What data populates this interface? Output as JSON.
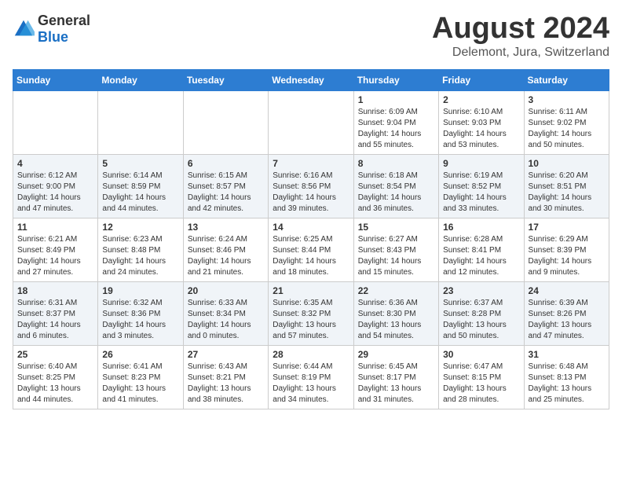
{
  "logo": {
    "general": "General",
    "blue": "Blue"
  },
  "title": "August 2024",
  "subtitle": "Delemont, Jura, Switzerland",
  "days_of_week": [
    "Sunday",
    "Monday",
    "Tuesday",
    "Wednesday",
    "Thursday",
    "Friday",
    "Saturday"
  ],
  "weeks": [
    [
      {
        "day": "",
        "info": ""
      },
      {
        "day": "",
        "info": ""
      },
      {
        "day": "",
        "info": ""
      },
      {
        "day": "",
        "info": ""
      },
      {
        "day": "1",
        "info": "Sunrise: 6:09 AM\nSunset: 9:04 PM\nDaylight: 14 hours\nand 55 minutes."
      },
      {
        "day": "2",
        "info": "Sunrise: 6:10 AM\nSunset: 9:03 PM\nDaylight: 14 hours\nand 53 minutes."
      },
      {
        "day": "3",
        "info": "Sunrise: 6:11 AM\nSunset: 9:02 PM\nDaylight: 14 hours\nand 50 minutes."
      }
    ],
    [
      {
        "day": "4",
        "info": "Sunrise: 6:12 AM\nSunset: 9:00 PM\nDaylight: 14 hours\nand 47 minutes."
      },
      {
        "day": "5",
        "info": "Sunrise: 6:14 AM\nSunset: 8:59 PM\nDaylight: 14 hours\nand 44 minutes."
      },
      {
        "day": "6",
        "info": "Sunrise: 6:15 AM\nSunset: 8:57 PM\nDaylight: 14 hours\nand 42 minutes."
      },
      {
        "day": "7",
        "info": "Sunrise: 6:16 AM\nSunset: 8:56 PM\nDaylight: 14 hours\nand 39 minutes."
      },
      {
        "day": "8",
        "info": "Sunrise: 6:18 AM\nSunset: 8:54 PM\nDaylight: 14 hours\nand 36 minutes."
      },
      {
        "day": "9",
        "info": "Sunrise: 6:19 AM\nSunset: 8:52 PM\nDaylight: 14 hours\nand 33 minutes."
      },
      {
        "day": "10",
        "info": "Sunrise: 6:20 AM\nSunset: 8:51 PM\nDaylight: 14 hours\nand 30 minutes."
      }
    ],
    [
      {
        "day": "11",
        "info": "Sunrise: 6:21 AM\nSunset: 8:49 PM\nDaylight: 14 hours\nand 27 minutes."
      },
      {
        "day": "12",
        "info": "Sunrise: 6:23 AM\nSunset: 8:48 PM\nDaylight: 14 hours\nand 24 minutes."
      },
      {
        "day": "13",
        "info": "Sunrise: 6:24 AM\nSunset: 8:46 PM\nDaylight: 14 hours\nand 21 minutes."
      },
      {
        "day": "14",
        "info": "Sunrise: 6:25 AM\nSunset: 8:44 PM\nDaylight: 14 hours\nand 18 minutes."
      },
      {
        "day": "15",
        "info": "Sunrise: 6:27 AM\nSunset: 8:43 PM\nDaylight: 14 hours\nand 15 minutes."
      },
      {
        "day": "16",
        "info": "Sunrise: 6:28 AM\nSunset: 8:41 PM\nDaylight: 14 hours\nand 12 minutes."
      },
      {
        "day": "17",
        "info": "Sunrise: 6:29 AM\nSunset: 8:39 PM\nDaylight: 14 hours\nand 9 minutes."
      }
    ],
    [
      {
        "day": "18",
        "info": "Sunrise: 6:31 AM\nSunset: 8:37 PM\nDaylight: 14 hours\nand 6 minutes."
      },
      {
        "day": "19",
        "info": "Sunrise: 6:32 AM\nSunset: 8:36 PM\nDaylight: 14 hours\nand 3 minutes."
      },
      {
        "day": "20",
        "info": "Sunrise: 6:33 AM\nSunset: 8:34 PM\nDaylight: 14 hours\nand 0 minutes."
      },
      {
        "day": "21",
        "info": "Sunrise: 6:35 AM\nSunset: 8:32 PM\nDaylight: 13 hours\nand 57 minutes."
      },
      {
        "day": "22",
        "info": "Sunrise: 6:36 AM\nSunset: 8:30 PM\nDaylight: 13 hours\nand 54 minutes."
      },
      {
        "day": "23",
        "info": "Sunrise: 6:37 AM\nSunset: 8:28 PM\nDaylight: 13 hours\nand 50 minutes."
      },
      {
        "day": "24",
        "info": "Sunrise: 6:39 AM\nSunset: 8:26 PM\nDaylight: 13 hours\nand 47 minutes."
      }
    ],
    [
      {
        "day": "25",
        "info": "Sunrise: 6:40 AM\nSunset: 8:25 PM\nDaylight: 13 hours\nand 44 minutes."
      },
      {
        "day": "26",
        "info": "Sunrise: 6:41 AM\nSunset: 8:23 PM\nDaylight: 13 hours\nand 41 minutes."
      },
      {
        "day": "27",
        "info": "Sunrise: 6:43 AM\nSunset: 8:21 PM\nDaylight: 13 hours\nand 38 minutes."
      },
      {
        "day": "28",
        "info": "Sunrise: 6:44 AM\nSunset: 8:19 PM\nDaylight: 13 hours\nand 34 minutes."
      },
      {
        "day": "29",
        "info": "Sunrise: 6:45 AM\nSunset: 8:17 PM\nDaylight: 13 hours\nand 31 minutes."
      },
      {
        "day": "30",
        "info": "Sunrise: 6:47 AM\nSunset: 8:15 PM\nDaylight: 13 hours\nand 28 minutes."
      },
      {
        "day": "31",
        "info": "Sunrise: 6:48 AM\nSunset: 8:13 PM\nDaylight: 13 hours\nand 25 minutes."
      }
    ]
  ]
}
